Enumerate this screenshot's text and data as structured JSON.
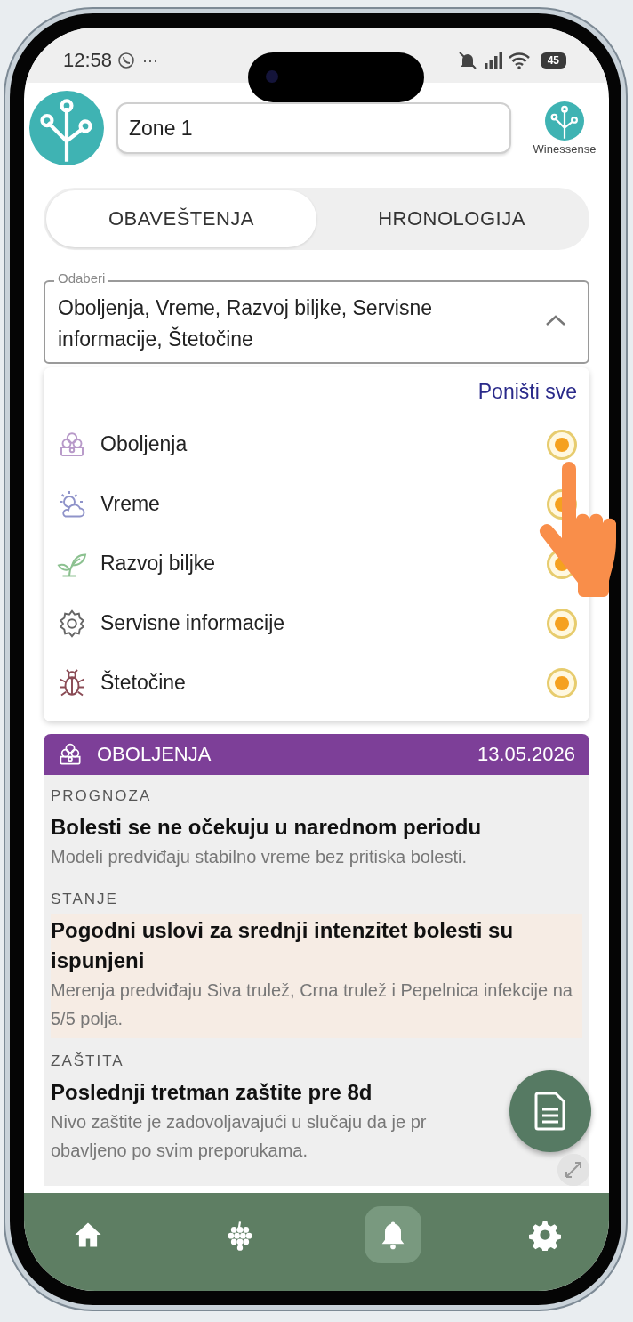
{
  "status_bar": {
    "time": "12:58",
    "more": "···",
    "battery": "45"
  },
  "header": {
    "zone": "Zone 1",
    "brand": "Winessense"
  },
  "tabs": [
    {
      "label": "OBAVEŠTENJA",
      "selected": true
    },
    {
      "label": "HRONOLOGIJA",
      "selected": false
    }
  ],
  "filter": {
    "label": "Odaberi",
    "value": "Oboljenja, Vreme, Razvoj biljke, Servisne informacije, Štetočine",
    "expanded": true,
    "clear_all": "Poništi sve",
    "options": [
      {
        "kind": "disease",
        "label": "Oboljenja",
        "checked": true
      },
      {
        "kind": "weather",
        "label": "Vreme",
        "checked": true
      },
      {
        "kind": "plant",
        "label": "Razvoj biljke",
        "checked": true
      },
      {
        "kind": "service",
        "label": "Servisne informacije",
        "checked": true
      },
      {
        "kind": "pest",
        "label": "Štetočine",
        "checked": true
      }
    ]
  },
  "card": {
    "kind": "disease",
    "title": "OBOLJENJA",
    "date": "13.05.2026",
    "sections": [
      {
        "label": "PROGNOZA",
        "title": "Bolesti se ne očekuju u narednom periodu",
        "text": "Modeli predviđaju stabilno vreme bez pritiska bolesti.",
        "highlighted": false
      },
      {
        "label": "STANJE",
        "title": "Pogodni uslovi za srednji intenzitet bolesti su ispunjeni",
        "text": "Merenja predviđaju Siva trulež, Crna trulež i Pepelnica infekcije na 5/5 polja.",
        "highlighted": true
      },
      {
        "label": "ZAŠTITA",
        "title": "Poslednji tretman zaštite pre 8d",
        "text": "Nivo zaštite je zadovoljavajući u slučaju da je pr",
        "text_2": "obavljeno po svim preporukama.",
        "highlighted": false
      }
    ]
  },
  "nav": [
    {
      "kind": "home",
      "selected": false
    },
    {
      "kind": "grapes",
      "selected": false
    },
    {
      "kind": "bell",
      "selected": true
    },
    {
      "kind": "settings",
      "selected": false
    }
  ]
}
